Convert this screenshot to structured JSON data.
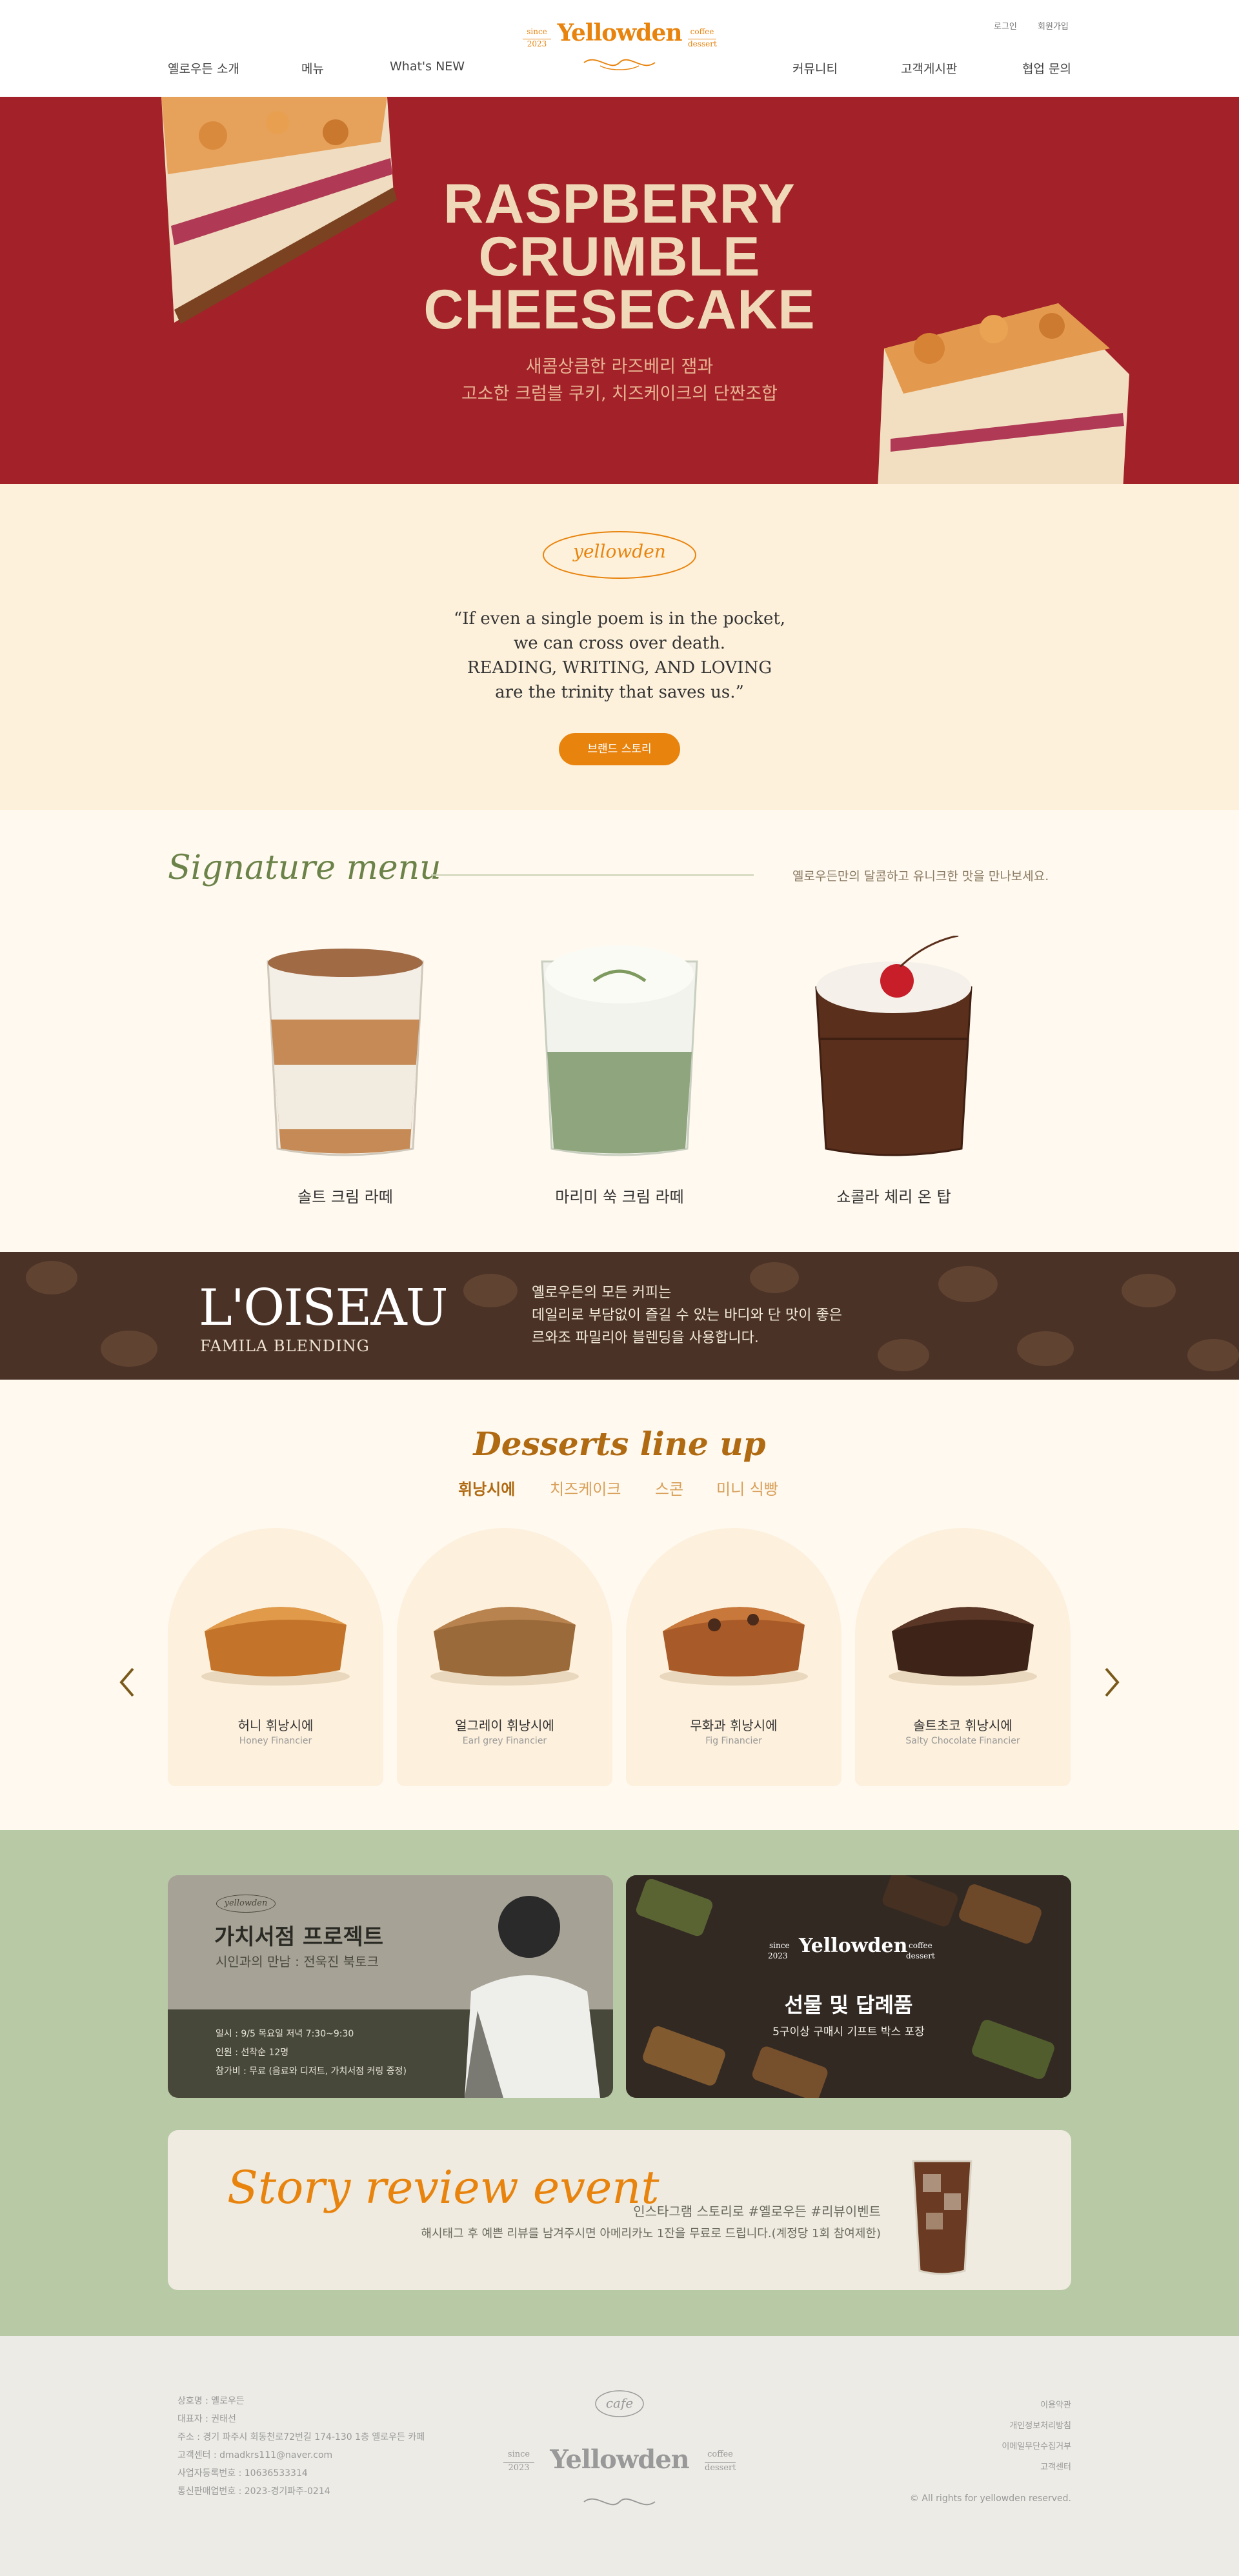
{
  "header": {
    "util_links": [
      "로그인",
      "회원가입"
    ],
    "nav_left": [
      "옐로우든 소개",
      "메뉴",
      "What's NEW"
    ],
    "nav_right": [
      "커뮤니티",
      "고객게시판",
      "협업 문의"
    ],
    "logo": {
      "name": "Yellowden",
      "left_top": "since",
      "left_bottom": "2023",
      "right_top": "coffee",
      "right_bottom": "dessert"
    }
  },
  "hero": {
    "title_lines": [
      "RASPBERRY",
      "CRUMBLE",
      "CHEESECAKE"
    ],
    "subtitle_lines": [
      "새콤상큼한 라즈베리 잼과",
      "고소한 크럼블 쿠키, 치즈케이크의 단짠조합"
    ]
  },
  "quote": {
    "badge": "yellowden",
    "lines": [
      "“If even a single poem is in the pocket,",
      "we can cross over death.",
      "READING, WRITING, AND LOVING",
      "are the trinity that saves us.”"
    ],
    "button": "브랜드 스토리"
  },
  "signature": {
    "title": "Signature menu",
    "description": "옐로우든만의 달콤하고 유니크한 맛을 만나보세요.",
    "items": [
      {
        "name": "솔트 크림 라떼"
      },
      {
        "name": "마리미 쑥 크림 라떼"
      },
      {
        "name": "쇼콜라 체리 온 탑"
      }
    ]
  },
  "loiseau": {
    "title": "L'OISEAU",
    "subtitle": "FAMILA BLENDING",
    "desc_lines": [
      "옐로우든의 모든 커피는",
      "데일리로 부담없이 즐길 수 있는 바디와 단 맛이 좋은",
      "르와조 파밀리아 블렌딩을 사용합니다."
    ]
  },
  "desserts": {
    "title": "Desserts line up",
    "tabs": [
      "휘낭시에",
      "치즈케이크",
      "스콘",
      "미니 식빵"
    ],
    "active_tab": "휘낭시에",
    "items": [
      {
        "ko": "허니 휘낭시에",
        "en": "Honey Financier"
      },
      {
        "ko": "얼그레이 휘낭시에",
        "en": "Earl grey Financier"
      },
      {
        "ko": "무화과 휘낭시에",
        "en": "Fig Financier"
      },
      {
        "ko": "솔트초코 휘낭시에",
        "en": "Salty Chocolate Financier"
      }
    ]
  },
  "events": {
    "project": {
      "badge": "yellowden",
      "title": "가치서점 프로젝트",
      "subtitle": "시인과의 만남 : 전욱진 북토크",
      "details": [
        "일시 : 9/5 목요일 저녁 7:30~9:30",
        "인원 : 선착순 12명",
        "참가비 : 무료 (음료와 디저트, 가치서점 커링 증정)"
      ]
    },
    "gift": {
      "title": "선물 및 답례품",
      "subtitle": "5구이상 구매시 기프트 박스 포장"
    },
    "review": {
      "title": "Story review event",
      "line1": "인스타그램 스토리로 #옐로우든 #리뷰이벤트",
      "line2": "해시태그 후 예쁜 리뷰를 남겨주시면 아메리카노 1잔을 무료로 드립니다.(계정당 1회 참여제한)"
    }
  },
  "footer": {
    "info": [
      "상호명 : 옐로우든",
      "대표자 : 권태선",
      "주소 : 경기 파주시 회동천로72번길 174-130 1층 옐로우든 카페",
      "고객센터 : dmadkrs111@naver.com",
      "사업자등록번호 : 10636533314",
      "통신판매업번호 : 2023-경기파주-0214"
    ],
    "badge": "cafe",
    "links": [
      "이용약관",
      "개인정보처리방침",
      "이메일무단수집거부",
      "고객센터"
    ],
    "copyright": "© All rights for yellowden reserved."
  },
  "colors": {
    "hero_bg": "#a32128",
    "accent": "#e8840e",
    "olive": "#6b8248",
    "events_bg": "#b8c9a5"
  }
}
